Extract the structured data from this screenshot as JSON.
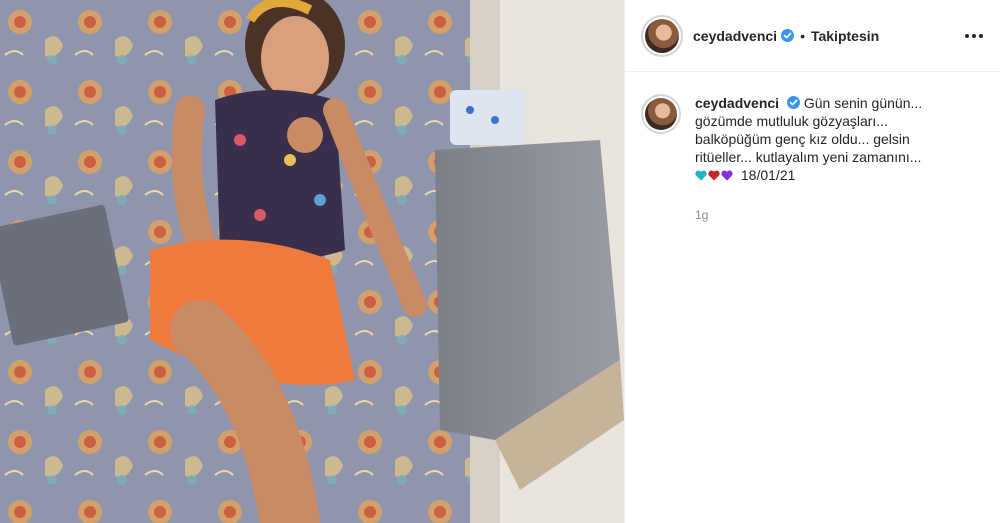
{
  "post": {
    "username": "ceydadvenci",
    "verified_icon": "verified-badge-icon",
    "separator": "•",
    "follow_status": "Takiptesin",
    "more_icon": "more-options-icon",
    "caption": {
      "username": "ceydadvenci",
      "text": "Gün senin günün... gözümde mutluluk gözyaşları... balköpüğüm genç kız oldu... gelsin ritüeller... kutlayalım yeni zamanını...",
      "emoji_hearts": [
        "#1fb6c7",
        "#c0282d",
        "#8a2be2"
      ],
      "date": "18/01/21"
    },
    "time_ago": "1g"
  },
  "colors": {
    "verified_blue": "#3897f0",
    "text_primary": "#262626",
    "text_secondary": "#8e8e8e",
    "border": "#efefef"
  }
}
